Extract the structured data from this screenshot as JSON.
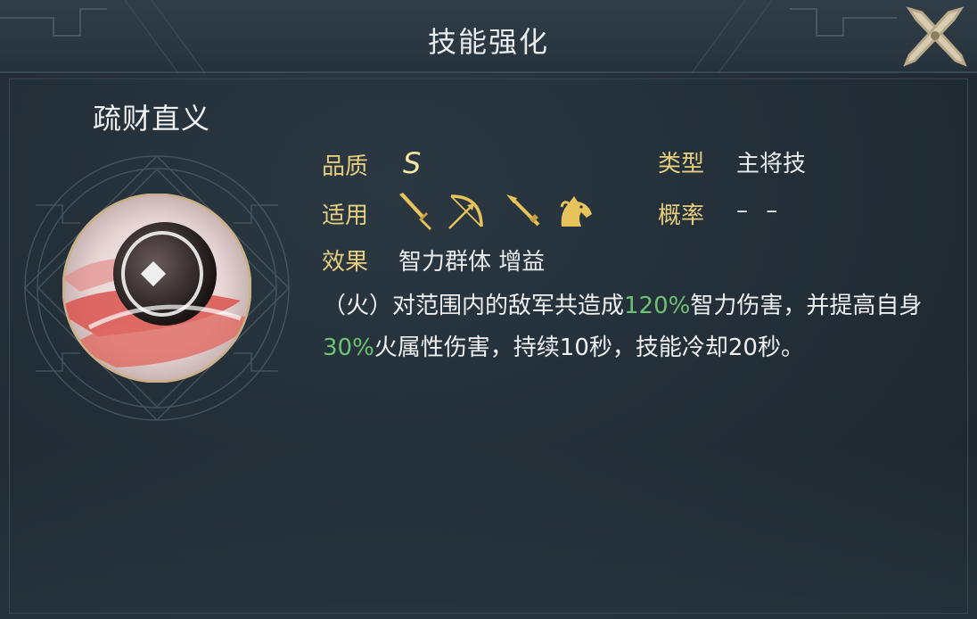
{
  "header": {
    "title": "技能强化"
  },
  "skill": {
    "name": "疏财直义",
    "quality_label": "品质",
    "quality_value": "S",
    "type_label": "类型",
    "type_value": "主将技",
    "applicable_label": "适用",
    "applicable_icons": [
      "sword-icon",
      "bow-icon",
      "spear-icon",
      "horse-icon"
    ],
    "probability_label": "概率",
    "probability_value": "– –",
    "effect_label": "效果",
    "effect_value": "智力群体 增益",
    "description": {
      "p1": "（火）对范围内的敌军共造成",
      "hl1": "120%",
      "p2": "智力伤害，并提高自身",
      "hl2": "30%",
      "p3": "火属性伤害，持续10秒，技能冷却20秒。"
    }
  },
  "colors": {
    "label": "#e5cf7e",
    "highlight": "#6cc172",
    "text": "#eef0f1",
    "icon_gold": "#e8c25a"
  }
}
